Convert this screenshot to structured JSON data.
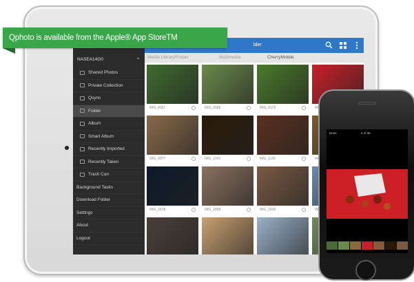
{
  "banner": {
    "text": "Qphoto is available from the Apple® App StoreTM"
  },
  "ipad": {
    "topbar_title": "lder",
    "breadcrumb": [
      "Media Library/Folder",
      "Multimedia",
      "CherryMobile"
    ],
    "sidebar": {
      "device": "NASEA14G0",
      "items": [
        {
          "label": "Shared Photos",
          "icon": "photos-icon"
        },
        {
          "label": "Private Collection",
          "icon": "lock-icon"
        },
        {
          "label": "Qsync",
          "icon": "sync-icon"
        },
        {
          "label": "Folder",
          "icon": "folder-icon",
          "active": true
        },
        {
          "label": "Album",
          "icon": "album-icon"
        },
        {
          "label": "Smart Album",
          "icon": "smart-album-icon"
        },
        {
          "label": "Recently Imported",
          "icon": "import-icon"
        },
        {
          "label": "Recently Taken",
          "icon": "camera-icon"
        },
        {
          "label": "Trash Can",
          "icon": "trash-icon"
        }
      ],
      "plain_items": [
        "Background Tasks",
        "Download Folder",
        "Settings",
        "About",
        "Logout"
      ]
    },
    "photos": [
      {
        "caption": "IMG_0067",
        "color": "#3f6b2f"
      },
      {
        "caption": "IMG_0088",
        "color": "#6b8a4a"
      },
      {
        "caption": "IMG_0375",
        "color": "#4a7a2b"
      },
      {
        "caption": "IMG_0076",
        "color": "#c8202a"
      },
      {
        "caption": "IMG_0077",
        "color": "#8a6a4a"
      },
      {
        "caption": "IMG_1041",
        "color": "#2a1a08"
      },
      {
        "caption": "IMG_1135",
        "color": "#5a3020"
      },
      {
        "caption": "IMG_1053",
        "color": "#7a5a2a"
      },
      {
        "caption": "IMG_1638",
        "color": "#0c1a2a"
      },
      {
        "caption": "IMG_1808",
        "color": "#8a7060"
      },
      {
        "caption": "IMG_1836",
        "color": "#7a5a44"
      },
      {
        "caption": "IMG_2117",
        "color": "#6a8ab0"
      },
      {
        "caption": "",
        "color": "#4a4038"
      },
      {
        "caption": "",
        "color": "#c8a070"
      },
      {
        "caption": "",
        "color": "#9ab0c8"
      },
      {
        "caption": "",
        "color": "#708a5a"
      }
    ]
  },
  "iphone": {
    "done_label": "Done",
    "counter": "4 of 36",
    "photo_color": "#cc1f26",
    "thumbs": [
      "#4a6a3a",
      "#6a8a4a",
      "#8a6a3a",
      "#c8202a",
      "#8a5a3a",
      "#2a1a08",
      "#7a5a44"
    ]
  },
  "colors": {
    "banner_green": "#3aa64a",
    "topbar_blue": "#2f78c9",
    "sidebar_dark": "#2b2b2b"
  }
}
